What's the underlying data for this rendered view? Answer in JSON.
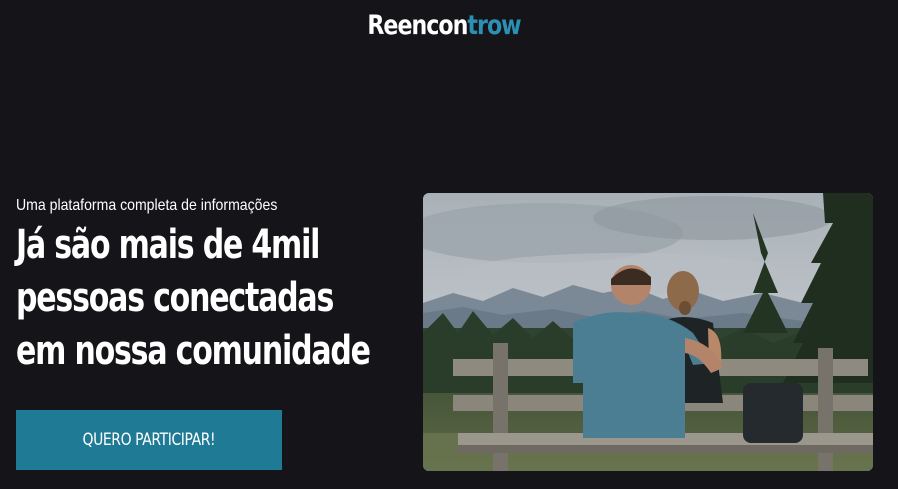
{
  "header": {
    "logo_part1": "Reencon",
    "logo_part2": "trow"
  },
  "hero": {
    "subtitle": "Uma plataforma completa de informações",
    "headline_line1": "Já são mais de 4mil",
    "headline_line2": "pessoas conectadas",
    "headline_line3": "em nossa comunidade",
    "cta_label": "QUERO PARTICIPAR!"
  },
  "colors": {
    "background": "#141419",
    "accent": "#2c8fb3",
    "button": "#1e7a95"
  }
}
